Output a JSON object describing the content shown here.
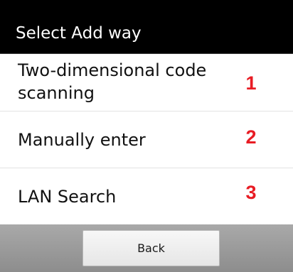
{
  "dialog": {
    "title": "Select Add way",
    "options": [
      {
        "label": "Two-dimensional code scanning",
        "number": "1"
      },
      {
        "label": "Manually enter",
        "number": "2"
      },
      {
        "label": "LAN Search",
        "number": "3"
      }
    ],
    "back_label": "Back"
  },
  "colors": {
    "title_bar": "#000000",
    "annotation": "#e81c24",
    "bottom_bar": "#9a9a9a"
  }
}
